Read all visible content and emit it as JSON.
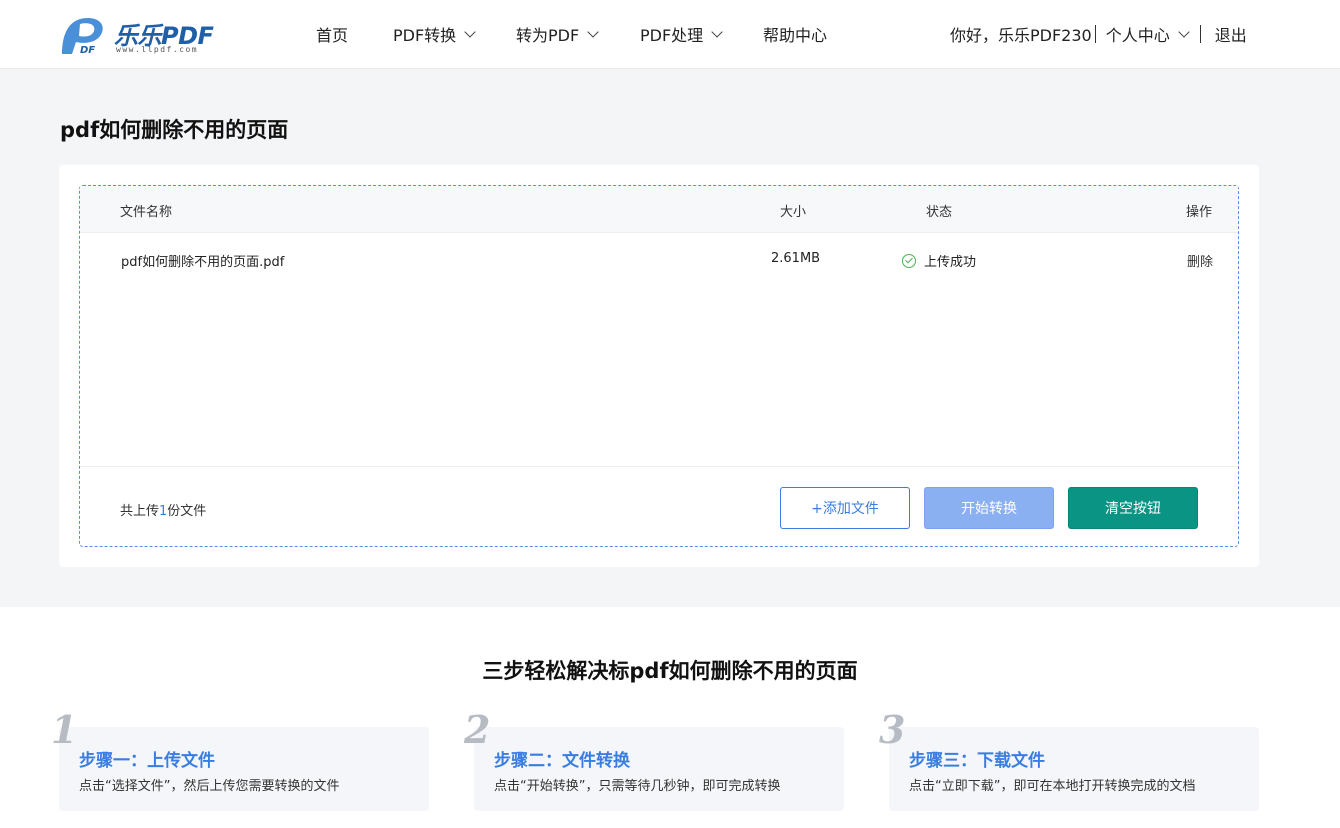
{
  "header": {
    "logo_text": "乐乐PDF",
    "logo_url": "www.llpdf.com",
    "nav": [
      {
        "label": "首页",
        "dropdown": false
      },
      {
        "label": "PDF转换",
        "dropdown": true
      },
      {
        "label": "转为PDF",
        "dropdown": true
      },
      {
        "label": "PDF处理",
        "dropdown": true
      },
      {
        "label": "帮助中心",
        "dropdown": false
      }
    ],
    "greeting": "你好，乐乐PDF230",
    "user_center": "个人中心",
    "logout": "退出"
  },
  "page_title": "pdf如何删除不用的页面",
  "table": {
    "columns": [
      "文件名称",
      "大小",
      "状态",
      "操作"
    ],
    "rows": [
      {
        "name": "pdf如何删除不用的页面.pdf",
        "size": "2.61MB",
        "status": "上传成功",
        "action": "删除"
      }
    ]
  },
  "footer": {
    "count_prefix": "共上传",
    "count": "1",
    "count_suffix": "份文件",
    "add_button": "+添加文件",
    "start_button": "开始转换",
    "clear_button": "清空按钮"
  },
  "steps_title": "三步轻松解决标pdf如何删除不用的页面",
  "steps": [
    {
      "num": "1",
      "title": "步骤一：上传文件",
      "desc": "点击“选择文件”，然后上传您需要转换的文件"
    },
    {
      "num": "2",
      "title": "步骤二：文件转换",
      "desc": "点击“开始转换”，只需等待几秒钟，即可完成转换"
    },
    {
      "num": "3",
      "title": "步骤三：下载文件",
      "desc": "点击“立即下载”，即可在本地打开转换完成的文档"
    }
  ],
  "colors": {
    "accent": "#3b7de0",
    "start_button": "#8bb0f2",
    "clear_button": "#0a9484",
    "success": "#4caf50"
  }
}
